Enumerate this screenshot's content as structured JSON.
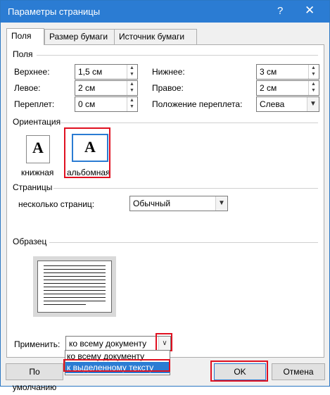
{
  "window": {
    "title": "Параметры страницы",
    "help": "?",
    "close": "✕"
  },
  "tabs": [
    {
      "label": "Поля"
    },
    {
      "label": "Размер бумаги"
    },
    {
      "label": "Источник бумаги"
    }
  ],
  "margins": {
    "section": "Поля",
    "top": {
      "label": "Верхнее:",
      "value": "1,5 см"
    },
    "bottom": {
      "label": "Нижнее:",
      "value": "3 см"
    },
    "left": {
      "label": "Левое:",
      "value": "2 см"
    },
    "right": {
      "label": "Правое:",
      "value": "2 см"
    },
    "gutter": {
      "label": "Переплет:",
      "value": "0 см"
    },
    "gutter_pos": {
      "label": "Положение переплета:",
      "value": "Слева"
    }
  },
  "orientation": {
    "section": "Ориентация",
    "portrait": {
      "label": "книжная",
      "glyph": "A"
    },
    "landscape": {
      "label": "альбомная",
      "glyph": "A"
    }
  },
  "pages": {
    "section": "Страницы",
    "multiple_label": "несколько страниц:",
    "multiple_value": "Обычный"
  },
  "sample": {
    "section": "Образец"
  },
  "apply": {
    "label": "Применить:",
    "value": "ко всему документу",
    "options": [
      "ко всему документу",
      "к выделенному тексту"
    ],
    "selected_index": 1
  },
  "buttons": {
    "default": "По умолчанию",
    "ok": "OK",
    "cancel": "Отмена"
  },
  "colors": {
    "accent": "#2b7cd3",
    "highlight": "#e01020"
  }
}
